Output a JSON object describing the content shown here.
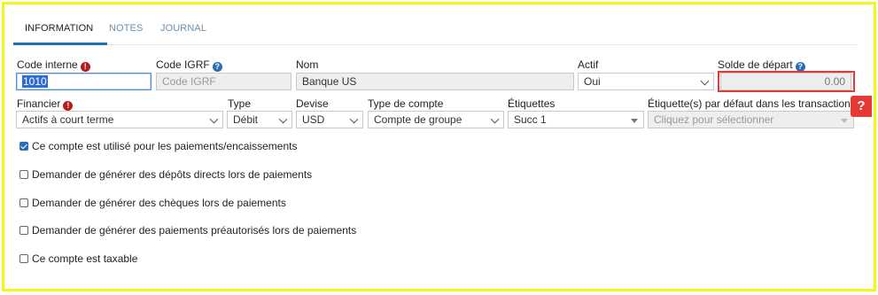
{
  "tabs": [
    {
      "label": "INFORMATION",
      "active": true
    },
    {
      "label": "NOTES",
      "active": false
    },
    {
      "label": "JOURNAL",
      "active": false
    }
  ],
  "fields": {
    "code_interne": {
      "label": "Code interne",
      "value": "1010",
      "icon": "error-icon"
    },
    "code_igrf": {
      "label": "Code IGRF",
      "placeholder": "Code IGRF",
      "icon": "info-icon"
    },
    "nom": {
      "label": "Nom",
      "value": "Banque US"
    },
    "actif": {
      "label": "Actif",
      "value": "Oui"
    },
    "solde": {
      "label": "Solde de départ",
      "value": "0.00",
      "icon": "info-icon"
    },
    "financier": {
      "label": "Financier",
      "value": "Actifs à court terme",
      "icon": "error-icon"
    },
    "type": {
      "label": "Type",
      "value": "Débit"
    },
    "devise": {
      "label": "Devise",
      "value": "USD"
    },
    "type_compte": {
      "label": "Type de compte",
      "value": "Compte de groupe"
    },
    "etiquettes": {
      "label": "Étiquettes",
      "value": "Succ 1"
    },
    "etiquettes_defaut": {
      "label": "Étiquette(s) par défaut dans les transactions",
      "placeholder": "Cliquez pour sélectionner"
    }
  },
  "checkboxes": [
    {
      "label": "Ce compte est utilisé pour les paiements/encaissements",
      "checked": true
    },
    {
      "label": "Demander de générer des dépôts directs lors de paiements",
      "checked": false
    },
    {
      "label": "Demander de générer des chèques lors de paiements",
      "checked": false
    },
    {
      "label": "Demander de générer des paiements préautorisés lors de paiements",
      "checked": false
    },
    {
      "label": "Ce compte est taxable",
      "checked": false
    }
  ],
  "help_button": {
    "label": "?"
  },
  "colors": {
    "highlight_border": "#f5f51a",
    "accent": "#1f6fb2",
    "error": "#e53935"
  }
}
